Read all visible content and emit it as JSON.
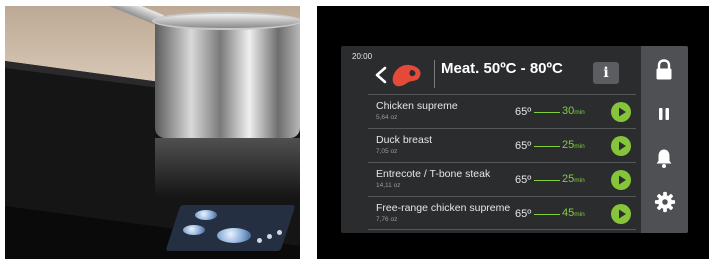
{
  "photo": {
    "description_icon": "induction-hob-photo"
  },
  "screen": {
    "clock": "20:00",
    "title": "Meat. 50ºC - 80ºC",
    "info_label": "i",
    "accent_color": "#86c53a",
    "recipes": [
      {
        "name": "Chicken supreme",
        "weight": "5,64 oz",
        "temp": "65º",
        "time_value": "30",
        "time_unit": "min"
      },
      {
        "name": "Duck breast",
        "weight": "7,05 oz",
        "temp": "65º",
        "time_value": "25",
        "time_unit": "min"
      },
      {
        "name": "Entrecote / T-bone steak",
        "weight": "14,11 oz",
        "temp": "65º",
        "time_value": "25",
        "time_unit": "min"
      },
      {
        "name": "Free-range chicken supreme",
        "weight": "7,76 oz",
        "temp": "65º",
        "time_value": "45",
        "time_unit": "min"
      }
    ],
    "sidebar_icons": [
      "lock-icon",
      "pause-icon",
      "bell-icon",
      "gear-icon"
    ]
  }
}
